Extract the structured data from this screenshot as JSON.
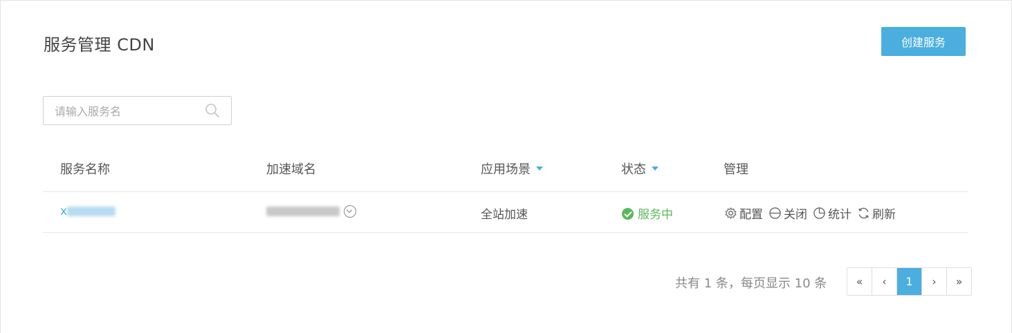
{
  "header": {
    "title": "服务管理 CDN",
    "create_button": "创建服务"
  },
  "search": {
    "placeholder": "请输入服务名",
    "value": ""
  },
  "table": {
    "columns": [
      "服务名称",
      "加速域名",
      "应用场景",
      "状态",
      "管理"
    ],
    "rows": [
      {
        "service_name_prefix": "x",
        "scenario": "全站加速",
        "status": "服务中",
        "actions": [
          "配置",
          "关闭",
          "统计",
          "刷新"
        ]
      }
    ]
  },
  "pagination": {
    "summary": "共有 1 条，每页显示 10 条",
    "first": "«",
    "prev": "‹",
    "current": "1",
    "next": "›",
    "last": "»"
  },
  "colors": {
    "accent": "#4aaede",
    "status_green": "#5cb85c"
  },
  "icons": [
    "search-icon",
    "chevron-down-circle-icon",
    "check-circle-icon",
    "gear-icon",
    "minus-circle-icon",
    "pie-chart-icon",
    "refresh-icon"
  ]
}
